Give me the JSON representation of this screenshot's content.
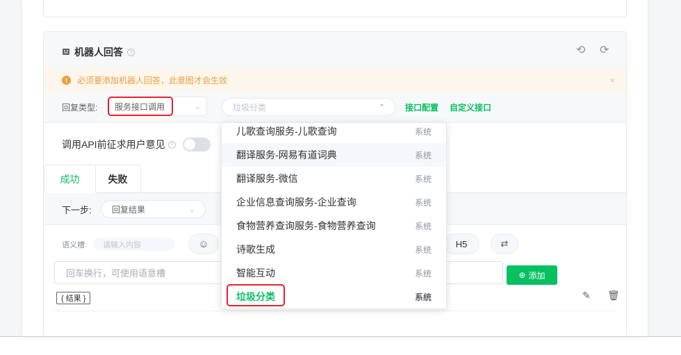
{
  "robot": {
    "title": "机器人回答",
    "help": "?",
    "undo": "⟲",
    "redo": "⟳",
    "alert": "必须要添加机器人回答，此意图才会生效",
    "alert_mark": "!",
    "alert_close": "×"
  },
  "reply": {
    "label": "回复类型:",
    "type_value": "服务接口调用",
    "service_placeholder": "垃圾分类",
    "link_config": "接口配置",
    "link_custom": "自定义接口",
    "chev_down": "⌄",
    "chev_up": "⌃"
  },
  "api": {
    "label": "调用API前征求用户意见",
    "help": "?"
  },
  "tabs": {
    "success": "成功",
    "fail": "失败"
  },
  "next": {
    "label": "下一步:",
    "value": "回复结果",
    "chev": "⌄"
  },
  "slot": {
    "label": "语义槽:",
    "placeholder": "请输入内容"
  },
  "toolbar": {
    "emoji": "☺",
    "h5": "H5",
    "fmt": "⇄"
  },
  "editor": {
    "placeholder": "回车换行，可使用语意槽",
    "add_label": "添加",
    "add_icon": "⊕"
  },
  "result": {
    "tag": "{ 结果 }",
    "edit_icon": "✎",
    "delete_icon": "🗑"
  },
  "dropdown": {
    "items": [
      {
        "label": "儿歌查询服务-儿歌查询",
        "tag": "系统"
      },
      {
        "label": "翻译服务-网易有道词典",
        "tag": "系统"
      },
      {
        "label": "翻译服务-微信",
        "tag": "系统"
      },
      {
        "label": "企业信息查询服务-企业查询",
        "tag": "系统"
      },
      {
        "label": "食物营养查询服务-食物营养查询",
        "tag": "系统"
      },
      {
        "label": "诗歌生成",
        "tag": "系统"
      },
      {
        "label": "智能互动",
        "tag": "系统"
      },
      {
        "label": "垃圾分类",
        "tag": "系统"
      }
    ]
  },
  "colors": {
    "accent": "#07c160",
    "warning": "#e6a23c",
    "highlight": "#e8202a"
  }
}
